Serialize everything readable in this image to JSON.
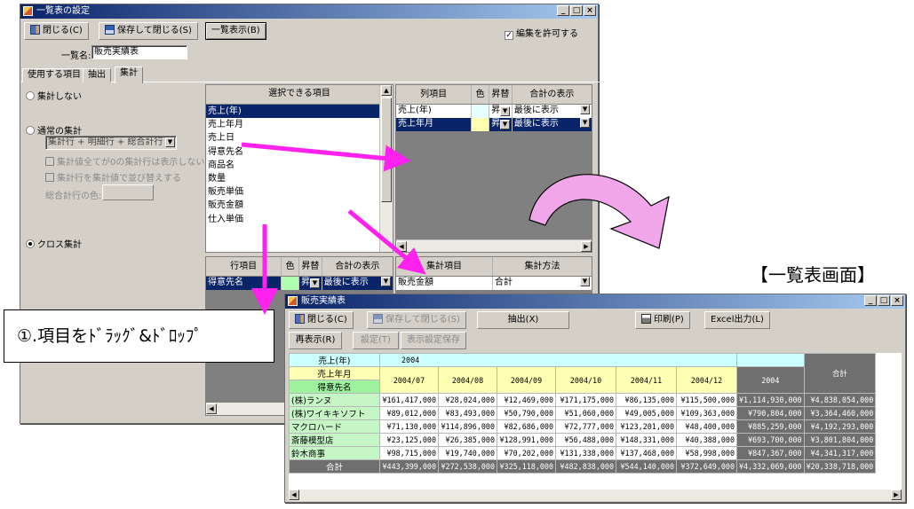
{
  "settings_window": {
    "title": "一覧表の設定",
    "toolbar": {
      "close_label": "閉じる(C)",
      "save_close_label": "保存して閉じる(S)",
      "list_view_label": "一覧表示(B)",
      "allow_edit_label": "編集を許可する",
      "allow_edit_checked": true
    },
    "list_name_label": "一覧名:",
    "list_name_value": "販売実績表",
    "tabs": [
      "使用する項目",
      "抽出",
      "集計"
    ],
    "active_tab": "集計",
    "options": {
      "no_aggregate": "集計しない",
      "normal_aggregate": "通常の集計",
      "aggregate_select": "集計行 + 明細行 + 総合計行",
      "hide_zero": "集計値全てが0の集計行は表示しない",
      "sort_by_value": "集計行を集計値で並び替えする",
      "total_color_label": "総合計行の色:",
      "cross_aggregate": "クロス集計",
      "selected_mode": "クロス集計"
    },
    "available_fields": {
      "header": "選択できる項目",
      "items": [
        "売上(年)",
        "売上年月",
        "売上日",
        "得意先名",
        "商品名",
        "数量",
        "販売単価",
        "販売金額",
        "仕入単価"
      ],
      "selected_index": 0
    },
    "column_fields": {
      "headers": [
        "列項目",
        "色",
        "昇替",
        "合計の表示"
      ],
      "rows": [
        {
          "name": "売上(年)",
          "sort": "昇",
          "total": "最後に表示",
          "color": "#e6ffff"
        },
        {
          "name": "売上年月",
          "sort": "昇",
          "total": "最後に表示",
          "color": "#ffffb0"
        }
      ]
    },
    "row_fields": {
      "headers": [
        "行項目",
        "色",
        "昇替",
        "合計の表示"
      ],
      "rows": [
        {
          "name": "得意先名",
          "sort": "昇",
          "total": "最後に表示",
          "color": "#b0ffb0"
        }
      ]
    },
    "aggregate_fields": {
      "headers": [
        "集計項目",
        "集計方法"
      ],
      "rows": [
        {
          "name": "販売金額",
          "method": "合計"
        }
      ]
    }
  },
  "callout": {
    "text": "①.項目をﾄﾞﾗｯｸﾞ&ﾄﾞﾛｯﾌﾟ"
  },
  "report_heading": "【一覧表画面】",
  "report_window": {
    "title": "販売実績表",
    "toolbar": {
      "close_label": "閉じる(C)",
      "save_close_label": "保存して閉じる(S)",
      "extract_label": "抽出(X)",
      "print_label": "印刷(P)",
      "excel_label": "Excel出力(L)",
      "redisplay_label": "再表示(R)",
      "settings_label": "設定(T)",
      "save_display_label": "表示設定保存"
    },
    "table": {
      "year_header": "売上(年)",
      "year_value": "2004",
      "month_header": "売上年月",
      "row_header": "得意先名",
      "months": [
        "2004/07",
        "2004/08",
        "2004/09",
        "2004/10",
        "2004/11",
        "2004/12"
      ],
      "subtotal_header": "2004",
      "total_header": "合計",
      "rows": [
        {
          "name": "(株)ランヌ",
          "values": [
            "¥161,417,000",
            "¥28,024,000",
            "¥12,469,000",
            "¥171,175,000",
            "¥86,135,000",
            "¥115,500,000"
          ],
          "subtotal": "¥1,114,930,000",
          "total": "¥4,838,054,000"
        },
        {
          "name": "(株)ワイキキソフト",
          "values": [
            "¥89,012,000",
            "¥83,493,000",
            "¥50,790,000",
            "¥51,060,000",
            "¥49,005,000",
            "¥109,363,000"
          ],
          "subtotal": "¥790,804,000",
          "total": "¥3,364,460,000"
        },
        {
          "name": "マクロハード",
          "values": [
            "¥71,130,000",
            "¥114,896,000",
            "¥82,686,000",
            "¥72,777,000",
            "¥123,201,000",
            "¥48,400,000"
          ],
          "subtotal": "¥885,259,000",
          "total": "¥4,192,293,000"
        },
        {
          "name": "斎藤模型店",
          "values": [
            "¥23,125,000",
            "¥26,385,000",
            "¥128,991,000",
            "¥56,488,000",
            "¥148,331,000",
            "¥40,388,000"
          ],
          "subtotal": "¥693,700,000",
          "total": "¥3,801,804,000"
        },
        {
          "name": "鈴木商事",
          "values": [
            "¥98,715,000",
            "¥19,740,000",
            "¥70,202,000",
            "¥131,338,000",
            "¥137,468,000",
            "¥58,998,000"
          ],
          "subtotal": "¥847,367,000",
          "total": "¥4,341,317,000"
        }
      ],
      "total_row": {
        "name": "合計",
        "values": [
          "¥443,399,000",
          "¥272,538,000",
          "¥325,118,000",
          "¥482,838,000",
          "¥544,140,000",
          "¥372,649,000"
        ],
        "subtotal": "¥4,332,069,000",
        "total": "¥20,338,718,000"
      }
    }
  },
  "colors": {
    "arrow_magenta": "#ff22ee",
    "curved_arrow_fill": "#f2a6ea",
    "title_bar": "#0a246a",
    "year_row_bg": "#ccffff",
    "month_row_bg": "#ffffb3",
    "row_label_bg": "#c6f5c6",
    "dark_cell": "#6f6f6f"
  }
}
